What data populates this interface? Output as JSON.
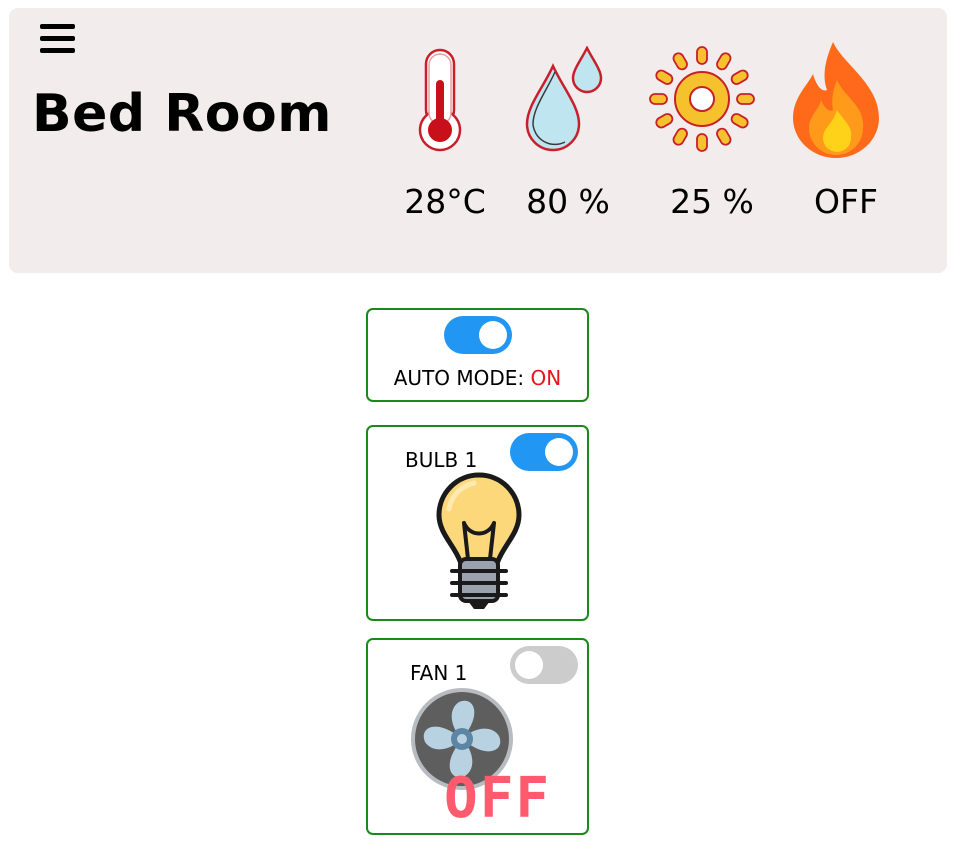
{
  "header": {
    "menu_icon": "hamburger-menu-icon",
    "room_name": "Bed Room",
    "sensors": [
      {
        "icon": "thermometer-icon",
        "value": "28°C"
      },
      {
        "icon": "water-drops-icon",
        "value": "80 %"
      },
      {
        "icon": "sun-icon",
        "value": "25 %"
      },
      {
        "icon": "fire-icon",
        "value": "OFF"
      }
    ]
  },
  "auto_mode": {
    "label": "AUTO MODE: ",
    "state": "ON",
    "toggle_on": true,
    "state_color": "#e8141b"
  },
  "devices": [
    {
      "label": "BULB 1",
      "icon": "light-bulb-icon",
      "toggle_on": true
    },
    {
      "label": "FAN 1",
      "icon": "fan-icon",
      "toggle_on": false,
      "state": "OFF",
      "state_color": "#ff5a6e"
    }
  ],
  "colors": {
    "header_bg": "#f2ecec",
    "card_border": "#1a8a1a",
    "toggle_on": "#2296f3",
    "toggle_off": "#cccccc"
  }
}
